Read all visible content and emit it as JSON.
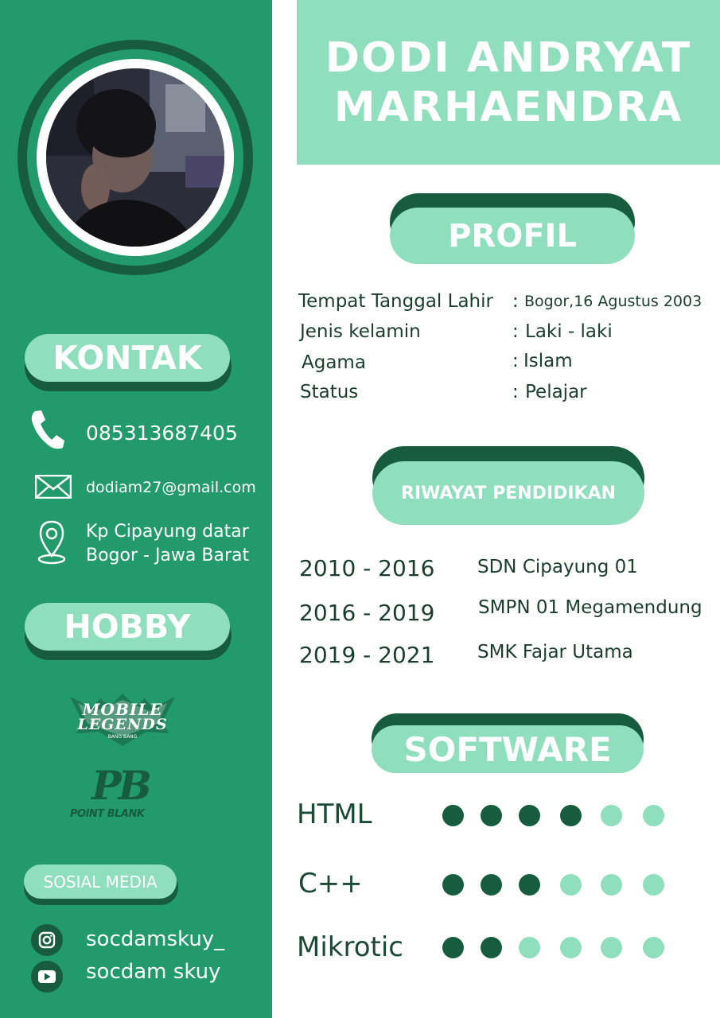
{
  "name": {
    "line1": "DODI ANDRYAT",
    "line2": "MARHAENDRA"
  },
  "colors": {
    "sidebar": "#229a6c",
    "dark": "#175c3f",
    "mint": "#8fdfbf",
    "text": "#1a3d2e"
  },
  "contact": {
    "heading": "KONTAK",
    "phone": "085313687405",
    "email": "dodiam27@gmail.com",
    "address_line1": "Kp Cipayung datar",
    "address_line2": "Bogor - Jawa Barat"
  },
  "hobby": {
    "heading": "HOBBY",
    "ml_line1": "MOBILE",
    "ml_line2": "LEGENDS",
    "ml_line3": "BANG BANG",
    "pb_mark": "PB",
    "pb_text": "POINT BLANK"
  },
  "social": {
    "heading": "SOSIAL MEDIA",
    "instagram": "socdamskuy_",
    "youtube": "socdam skuy"
  },
  "profile": {
    "heading": "PROFIL",
    "rows": [
      {
        "label": "Tempat Tanggal  Lahir",
        "value": "Bogor,16 Agustus 2003"
      },
      {
        "label": "Jenis kelamin",
        "value": "Laki - laki"
      },
      {
        "label": "Agama",
        "value": "Islam"
      },
      {
        "label": "Status",
        "value": "Pelajar"
      }
    ]
  },
  "education": {
    "heading": "RIWAYAT PENDIDIKAN",
    "rows": [
      {
        "years": "2010 - 2016",
        "school": "SDN Cipayung 01"
      },
      {
        "years": "2016 - 2019",
        "school": "SMPN 01 Megamendung"
      },
      {
        "years": "2019 - 2021",
        "school": "SMK Fajar Utama"
      }
    ]
  },
  "software": {
    "heading": "SOFTWARE",
    "max": 6,
    "items": [
      {
        "name": "HTML",
        "level": 4
      },
      {
        "name": "C++",
        "level": 3
      },
      {
        "name": "Mikrotic",
        "level": 2
      }
    ]
  }
}
